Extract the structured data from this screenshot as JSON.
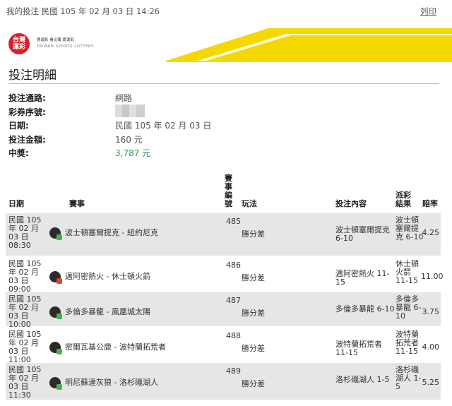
{
  "header": {
    "breadcrumb": "我的投注  民國 105 年 02 月 03 日 14:26",
    "print_label": "列印"
  },
  "brand": {
    "logo_line1": "台灣",
    "logo_line2": "運彩",
    "tagline": "賣運彩  看比賽  愛運彩",
    "english": "TAIWAN SPORTS LOTTERY",
    "accent_color": "#f5d800",
    "logo_color": "#d6202b"
  },
  "page_title": "投注明細",
  "info": {
    "channel_label": "投注通路:",
    "channel_value": "網路",
    "serial_label": "彩券序號:",
    "date_label": "日期:",
    "date_value": "民國 105 年 02 月 03 日",
    "amount_label": "投注金額:",
    "amount_value": "160 元",
    "win_label": "中獎:",
    "win_value": "3,787 元",
    "win_color": "#2d9a52"
  },
  "table": {
    "headers": {
      "date": "日期",
      "event": "賽事",
      "event_no": "賽事編號",
      "play": "玩法",
      "bet": "投注內容",
      "result": "派彩結果",
      "odds": "賠率"
    },
    "rows": [
      {
        "date": "民國 105 年 02 月 03 日 08:30",
        "icon": "basketball-icon",
        "event": "波士頓塞爾提克 - 紐約尼克",
        "no": "485",
        "play": "勝分差",
        "bet": "波士頓塞爾提克 6-10",
        "result": "波士頓塞爾提克 6-10",
        "odds": "4.25"
      },
      {
        "date": "民國 105 年 02 月 03 日 09:00",
        "icon": "basketball-icon",
        "event": "邁阿密熱火 - 休士頓火箭",
        "no": "486",
        "play": "勝分差",
        "bet": "邁阿密熱火 11-15",
        "result": "休士頓火箭 11-15",
        "odds": "11.00"
      },
      {
        "date": "民國 105 年 02 月 03 日 10:00",
        "icon": "basketball-icon",
        "event": "多倫多暴龍 - 鳳凰城太陽",
        "no": "487",
        "play": "勝分差",
        "bet": "多倫多暴龍 6-10",
        "result": "多倫多暴龍 6-10",
        "odds": "3.75"
      },
      {
        "date": "民國 105 年 02 月 03 日 11:00",
        "icon": "basketball-icon",
        "event": "密爾瓦基公鹿 - 波特蘭拓荒者",
        "no": "488",
        "play": "勝分差",
        "bet": "波特蘭拓荒者 11-15",
        "result": "波特蘭拓荒者 11-15",
        "odds": "4.00"
      },
      {
        "date": "民國 105 年 02 月 03 日 11:30",
        "icon": "basketball-icon",
        "event": "明尼蘇達灰狼 - 洛杉磯湖人",
        "no": "489",
        "play": "勝分差",
        "bet": "洛杉磯湖人 1-5",
        "result": "洛杉磯湖人 1-5",
        "odds": "5.25"
      }
    ]
  }
}
